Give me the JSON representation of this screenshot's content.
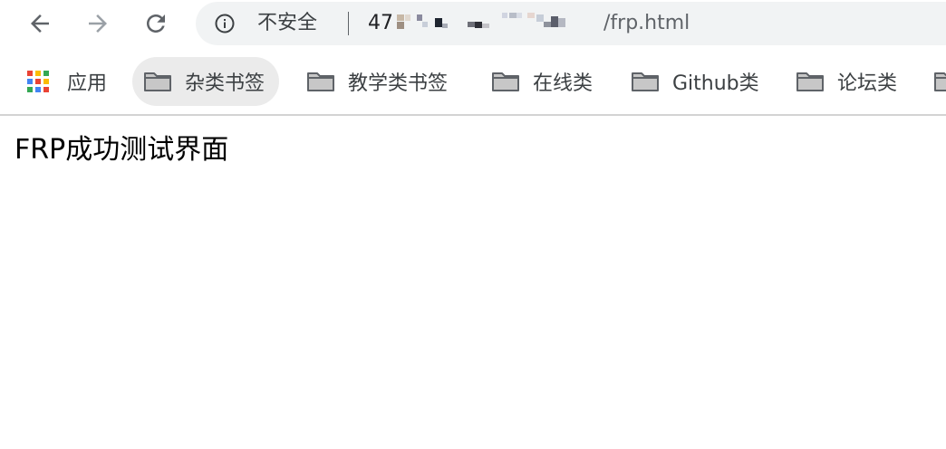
{
  "toolbar": {
    "back_icon": "arrow-left-icon",
    "forward_icon": "arrow-right-icon",
    "reload_icon": "reload-icon"
  },
  "omnibox": {
    "security_icon": "info-circle-icon",
    "security_label": "不安全",
    "url_prefix": "47",
    "url_path": "/frp.html"
  },
  "bookmarks": {
    "items": [
      {
        "label": "应用",
        "icon": "apps-grid-icon"
      },
      {
        "label": "杂类书签",
        "icon": "folder-icon"
      },
      {
        "label": "教学类书签",
        "icon": "folder-icon"
      },
      {
        "label": "在线类",
        "icon": "folder-icon"
      },
      {
        "label": "Github类",
        "icon": "folder-icon"
      },
      {
        "label": "论坛类",
        "icon": "folder-icon"
      },
      {
        "label": "",
        "icon": "folder-icon"
      }
    ]
  },
  "page": {
    "heading": "FRP成功测试界面"
  },
  "colors": {
    "chrome_text": "#3c4043",
    "omnibox_bg": "#f1f3f4",
    "bookmark_active_bg": "#ebebeb",
    "folder_icon": "#5f6368",
    "forward_disabled": "#9aa0a6"
  }
}
